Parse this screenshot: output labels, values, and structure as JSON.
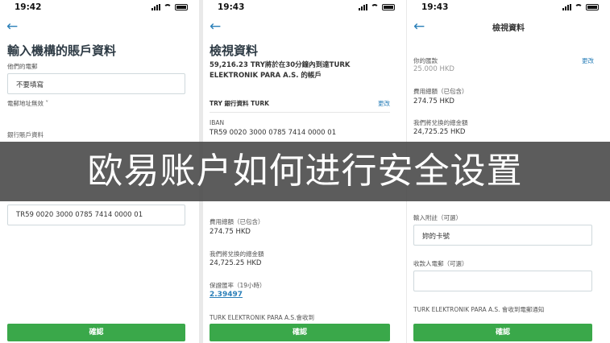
{
  "screen1": {
    "time": "19:42",
    "title": "輸入機構的賬戶資料",
    "phone_label": "他們的電郵",
    "phone_value": "不要填寫",
    "email_invalid": "電郵地址無效",
    "bank_section": "銀行賬戶資料",
    "iban_value": "TR59 0020 3000 0785 7414 0000 01",
    "confirm_button": "確認"
  },
  "screen2": {
    "time": "19:43",
    "title": "檢視資料",
    "summary_line1": "59,216.23 TRY將於在30分鐘內到達TURK",
    "summary_line2": "ELEKTRONIK PARA A.S. 的帳戶",
    "bank_label": "TRY 銀行資料 TURK",
    "edit_link": "更改",
    "iban_label": "IBAN",
    "iban_value": "TR59 0020 3000 0785 7414 0000 01",
    "fee_label": "費用總額（已包含）",
    "fee_value": "274.75 HKD",
    "total_label": "我們將兌換的總金額",
    "total_value": "24,725.25 HKD",
    "rate_label": "保證匯率（19小時）",
    "rate_value": "2.39497",
    "recipient_note": "TURK ELEKTRONIK PARA A.S.會收到",
    "confirm_button": "確認"
  },
  "screen3": {
    "time": "19:43",
    "nav_title": "檢視資料",
    "amount_label": "你的匯款",
    "amount_value": "25,000 HKD",
    "edit_link": "更改",
    "fee_label": "費用總額（已包含）",
    "fee_value": "274.75 HKD",
    "total_label": "我們將兌換的總金額",
    "total_value": "24,725.25 HKD",
    "note_label": "輸入附註（可選）",
    "note_value": "妳的卡號",
    "recipient_email_label": "收款人電郵（可選）",
    "recipient_email_value": "",
    "notice": "TURK ELEKTRONIK PARA A.S. 會收到電郵通知",
    "confirm_button": "確認"
  },
  "banner": {
    "text": "欧易账户如何进行安全设置"
  },
  "colors": {
    "accent": "#2a7fb8",
    "button": "#3aa84a",
    "banner_bg": "#464646"
  }
}
